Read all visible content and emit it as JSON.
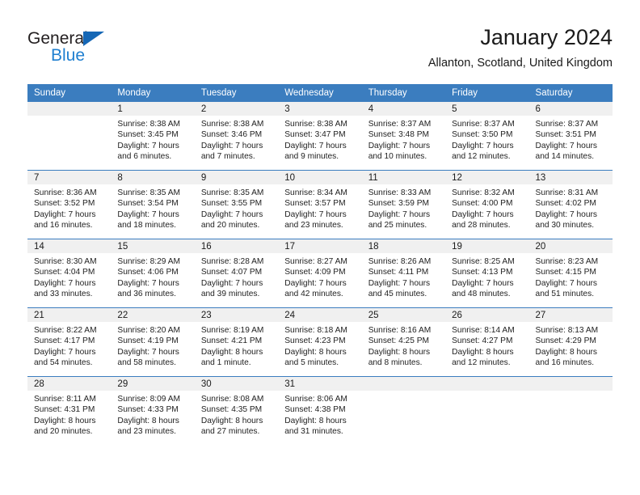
{
  "brand": {
    "name_part1": "General",
    "name_part2": "Blue",
    "accent_color": "#1f7fd0",
    "triangle_color": "#1567b5"
  },
  "header": {
    "title": "January 2024",
    "subtitle": "Allanton, Scotland, United Kingdom"
  },
  "theme": {
    "header_row_color": "#3b7dbf",
    "daynum_band_color": "#f0f0f0",
    "text_color": "#1a1a1a"
  },
  "weekdays": [
    "Sunday",
    "Monday",
    "Tuesday",
    "Wednesday",
    "Thursday",
    "Friday",
    "Saturday"
  ],
  "weeks": [
    [
      {
        "day": "",
        "sunrise": "",
        "sunset": "",
        "daylight_line1": "",
        "daylight_line2": ""
      },
      {
        "day": "1",
        "sunrise": "Sunrise: 8:38 AM",
        "sunset": "Sunset: 3:45 PM",
        "daylight_line1": "Daylight: 7 hours",
        "daylight_line2": "and 6 minutes."
      },
      {
        "day": "2",
        "sunrise": "Sunrise: 8:38 AM",
        "sunset": "Sunset: 3:46 PM",
        "daylight_line1": "Daylight: 7 hours",
        "daylight_line2": "and 7 minutes."
      },
      {
        "day": "3",
        "sunrise": "Sunrise: 8:38 AM",
        "sunset": "Sunset: 3:47 PM",
        "daylight_line1": "Daylight: 7 hours",
        "daylight_line2": "and 9 minutes."
      },
      {
        "day": "4",
        "sunrise": "Sunrise: 8:37 AM",
        "sunset": "Sunset: 3:48 PM",
        "daylight_line1": "Daylight: 7 hours",
        "daylight_line2": "and 10 minutes."
      },
      {
        "day": "5",
        "sunrise": "Sunrise: 8:37 AM",
        "sunset": "Sunset: 3:50 PM",
        "daylight_line1": "Daylight: 7 hours",
        "daylight_line2": "and 12 minutes."
      },
      {
        "day": "6",
        "sunrise": "Sunrise: 8:37 AM",
        "sunset": "Sunset: 3:51 PM",
        "daylight_line1": "Daylight: 7 hours",
        "daylight_line2": "and 14 minutes."
      }
    ],
    [
      {
        "day": "7",
        "sunrise": "Sunrise: 8:36 AM",
        "sunset": "Sunset: 3:52 PM",
        "daylight_line1": "Daylight: 7 hours",
        "daylight_line2": "and 16 minutes."
      },
      {
        "day": "8",
        "sunrise": "Sunrise: 8:35 AM",
        "sunset": "Sunset: 3:54 PM",
        "daylight_line1": "Daylight: 7 hours",
        "daylight_line2": "and 18 minutes."
      },
      {
        "day": "9",
        "sunrise": "Sunrise: 8:35 AM",
        "sunset": "Sunset: 3:55 PM",
        "daylight_line1": "Daylight: 7 hours",
        "daylight_line2": "and 20 minutes."
      },
      {
        "day": "10",
        "sunrise": "Sunrise: 8:34 AM",
        "sunset": "Sunset: 3:57 PM",
        "daylight_line1": "Daylight: 7 hours",
        "daylight_line2": "and 23 minutes."
      },
      {
        "day": "11",
        "sunrise": "Sunrise: 8:33 AM",
        "sunset": "Sunset: 3:59 PM",
        "daylight_line1": "Daylight: 7 hours",
        "daylight_line2": "and 25 minutes."
      },
      {
        "day": "12",
        "sunrise": "Sunrise: 8:32 AM",
        "sunset": "Sunset: 4:00 PM",
        "daylight_line1": "Daylight: 7 hours",
        "daylight_line2": "and 28 minutes."
      },
      {
        "day": "13",
        "sunrise": "Sunrise: 8:31 AM",
        "sunset": "Sunset: 4:02 PM",
        "daylight_line1": "Daylight: 7 hours",
        "daylight_line2": "and 30 minutes."
      }
    ],
    [
      {
        "day": "14",
        "sunrise": "Sunrise: 8:30 AM",
        "sunset": "Sunset: 4:04 PM",
        "daylight_line1": "Daylight: 7 hours",
        "daylight_line2": "and 33 minutes."
      },
      {
        "day": "15",
        "sunrise": "Sunrise: 8:29 AM",
        "sunset": "Sunset: 4:06 PM",
        "daylight_line1": "Daylight: 7 hours",
        "daylight_line2": "and 36 minutes."
      },
      {
        "day": "16",
        "sunrise": "Sunrise: 8:28 AM",
        "sunset": "Sunset: 4:07 PM",
        "daylight_line1": "Daylight: 7 hours",
        "daylight_line2": "and 39 minutes."
      },
      {
        "day": "17",
        "sunrise": "Sunrise: 8:27 AM",
        "sunset": "Sunset: 4:09 PM",
        "daylight_line1": "Daylight: 7 hours",
        "daylight_line2": "and 42 minutes."
      },
      {
        "day": "18",
        "sunrise": "Sunrise: 8:26 AM",
        "sunset": "Sunset: 4:11 PM",
        "daylight_line1": "Daylight: 7 hours",
        "daylight_line2": "and 45 minutes."
      },
      {
        "day": "19",
        "sunrise": "Sunrise: 8:25 AM",
        "sunset": "Sunset: 4:13 PM",
        "daylight_line1": "Daylight: 7 hours",
        "daylight_line2": "and 48 minutes."
      },
      {
        "day": "20",
        "sunrise": "Sunrise: 8:23 AM",
        "sunset": "Sunset: 4:15 PM",
        "daylight_line1": "Daylight: 7 hours",
        "daylight_line2": "and 51 minutes."
      }
    ],
    [
      {
        "day": "21",
        "sunrise": "Sunrise: 8:22 AM",
        "sunset": "Sunset: 4:17 PM",
        "daylight_line1": "Daylight: 7 hours",
        "daylight_line2": "and 54 minutes."
      },
      {
        "day": "22",
        "sunrise": "Sunrise: 8:20 AM",
        "sunset": "Sunset: 4:19 PM",
        "daylight_line1": "Daylight: 7 hours",
        "daylight_line2": "and 58 minutes."
      },
      {
        "day": "23",
        "sunrise": "Sunrise: 8:19 AM",
        "sunset": "Sunset: 4:21 PM",
        "daylight_line1": "Daylight: 8 hours",
        "daylight_line2": "and 1 minute."
      },
      {
        "day": "24",
        "sunrise": "Sunrise: 8:18 AM",
        "sunset": "Sunset: 4:23 PM",
        "daylight_line1": "Daylight: 8 hours",
        "daylight_line2": "and 5 minutes."
      },
      {
        "day": "25",
        "sunrise": "Sunrise: 8:16 AM",
        "sunset": "Sunset: 4:25 PM",
        "daylight_line1": "Daylight: 8 hours",
        "daylight_line2": "and 8 minutes."
      },
      {
        "day": "26",
        "sunrise": "Sunrise: 8:14 AM",
        "sunset": "Sunset: 4:27 PM",
        "daylight_line1": "Daylight: 8 hours",
        "daylight_line2": "and 12 minutes."
      },
      {
        "day": "27",
        "sunrise": "Sunrise: 8:13 AM",
        "sunset": "Sunset: 4:29 PM",
        "daylight_line1": "Daylight: 8 hours",
        "daylight_line2": "and 16 minutes."
      }
    ],
    [
      {
        "day": "28",
        "sunrise": "Sunrise: 8:11 AM",
        "sunset": "Sunset: 4:31 PM",
        "daylight_line1": "Daylight: 8 hours",
        "daylight_line2": "and 20 minutes."
      },
      {
        "day": "29",
        "sunrise": "Sunrise: 8:09 AM",
        "sunset": "Sunset: 4:33 PM",
        "daylight_line1": "Daylight: 8 hours",
        "daylight_line2": "and 23 minutes."
      },
      {
        "day": "30",
        "sunrise": "Sunrise: 8:08 AM",
        "sunset": "Sunset: 4:35 PM",
        "daylight_line1": "Daylight: 8 hours",
        "daylight_line2": "and 27 minutes."
      },
      {
        "day": "31",
        "sunrise": "Sunrise: 8:06 AM",
        "sunset": "Sunset: 4:38 PM",
        "daylight_line1": "Daylight: 8 hours",
        "daylight_line2": "and 31 minutes."
      },
      {
        "day": "",
        "sunrise": "",
        "sunset": "",
        "daylight_line1": "",
        "daylight_line2": ""
      },
      {
        "day": "",
        "sunrise": "",
        "sunset": "",
        "daylight_line1": "",
        "daylight_line2": ""
      },
      {
        "day": "",
        "sunrise": "",
        "sunset": "",
        "daylight_line1": "",
        "daylight_line2": ""
      }
    ]
  ]
}
